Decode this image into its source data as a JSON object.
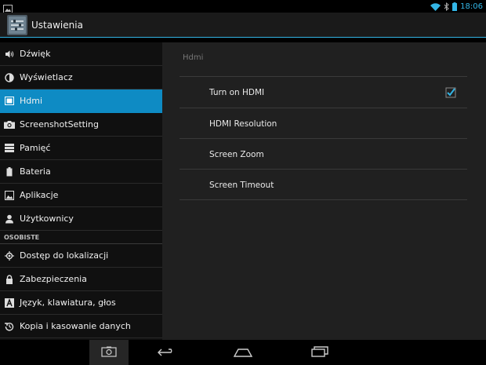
{
  "status_bar": {
    "time": "18:06",
    "icons": [
      "image-notification-icon",
      "wifi-icon",
      "bluetooth-icon",
      "battery-icon"
    ],
    "accent": "#33b5e5"
  },
  "action_bar": {
    "title": "Ustawienia",
    "icon": "settings-app-icon"
  },
  "sidebar": {
    "items": [
      {
        "label": "Dźwięk",
        "icon": "speaker-icon"
      },
      {
        "label": "Wyświetlacz",
        "icon": "brightness-icon"
      },
      {
        "label": "Hdmi",
        "icon": "hdmi-icon",
        "selected": true
      },
      {
        "label": "ScreenshotSetting",
        "icon": "camera-icon"
      },
      {
        "label": "Pamięć",
        "icon": "storage-icon"
      },
      {
        "label": "Bateria",
        "icon": "battery-icon"
      },
      {
        "label": "Aplikacje",
        "icon": "apps-icon"
      },
      {
        "label": "Użytkownicy",
        "icon": "user-icon"
      }
    ],
    "section_header": "OSOBISTE",
    "personal_items": [
      {
        "label": "Dostęp do lokalizacji",
        "icon": "location-icon"
      },
      {
        "label": "Zabezpieczenia",
        "icon": "lock-icon"
      },
      {
        "label": "Język, klawiatura, głos",
        "icon": "language-icon"
      },
      {
        "label": "Kopia i kasowanie danych",
        "icon": "backup-icon"
      }
    ],
    "selected_color": "#0e8bc4"
  },
  "content": {
    "title": "Hdmi",
    "preferences": [
      {
        "label": "Turn on HDMI",
        "checked": true
      },
      {
        "label": "HDMI Resolution"
      },
      {
        "label": "Screen Zoom"
      },
      {
        "label": "Screen Timeout"
      }
    ]
  },
  "nav_bar": {
    "buttons": [
      "screenshot-icon",
      "back-icon",
      "home-icon",
      "recent-apps-icon"
    ]
  }
}
